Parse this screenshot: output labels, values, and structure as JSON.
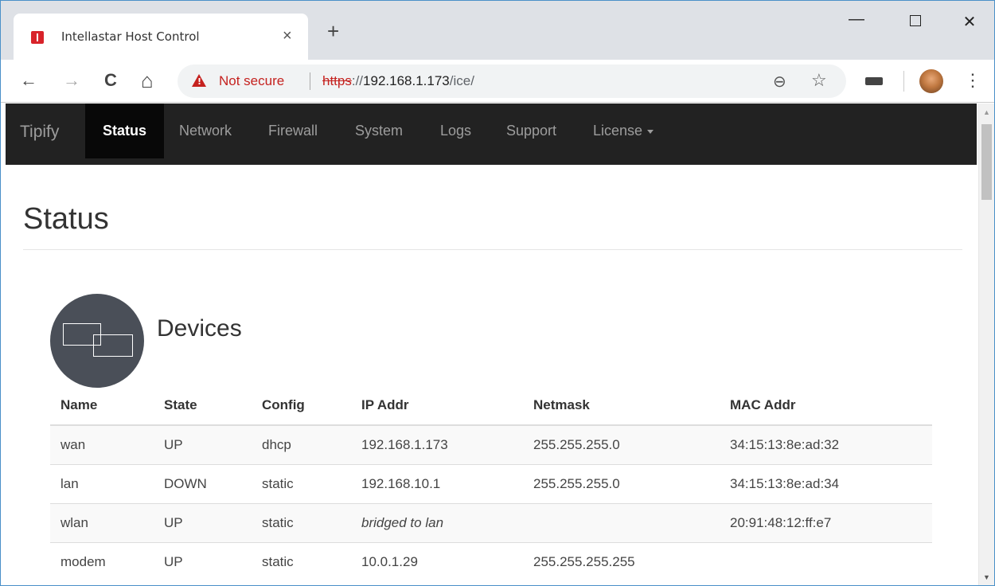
{
  "browser": {
    "tab_title": "Intellastar Host Control",
    "tab_close": "×",
    "new_tab": "+",
    "minimize": "—",
    "close": "✕",
    "back": "←",
    "forward": "→",
    "reload": "C",
    "home": "⌂",
    "security_label": "Not secure",
    "url_scheme": "https",
    "url_sep": "://",
    "url_host": "192.168.1.173",
    "url_path": "/ice/",
    "zoom": "⊖",
    "bookmark": "☆",
    "menu": "⋮"
  },
  "navbar": {
    "brand": "Tipify",
    "items": [
      {
        "label": "Status",
        "active": true
      },
      {
        "label": "Network"
      },
      {
        "label": "Firewall"
      },
      {
        "label": "System"
      },
      {
        "label": "Logs"
      },
      {
        "label": "Support"
      },
      {
        "label": "License"
      }
    ]
  },
  "page": {
    "title": "Status",
    "section_title": "Devices"
  },
  "devices_table": {
    "columns": [
      "Name",
      "State",
      "Config",
      "IP Addr",
      "Netmask",
      "MAC Addr"
    ],
    "rows": [
      [
        "wan",
        "UP",
        "dhcp",
        "192.168.1.173",
        "255.255.255.0",
        "34:15:13:8e:ad:32"
      ],
      [
        "lan",
        "DOWN",
        "static",
        "192.168.10.1",
        "255.255.255.0",
        "34:15:13:8e:ad:34"
      ],
      [
        "wlan",
        "UP",
        "static",
        "bridged to lan",
        "",
        "20:91:48:12:ff:e7"
      ],
      [
        "modem",
        "UP",
        "static",
        "10.0.1.29",
        "255.255.255.255",
        ""
      ]
    ]
  },
  "colors": {
    "navbar_bg": "#222222",
    "navbar_active_bg": "#080808",
    "warning_red": "#c5221f",
    "device_icon_bg": "#4a4f58"
  },
  "icons": [
    "lock-warning-icon",
    "zoom-icon",
    "star-icon",
    "extension-icon",
    "avatar",
    "devices-icon"
  ]
}
